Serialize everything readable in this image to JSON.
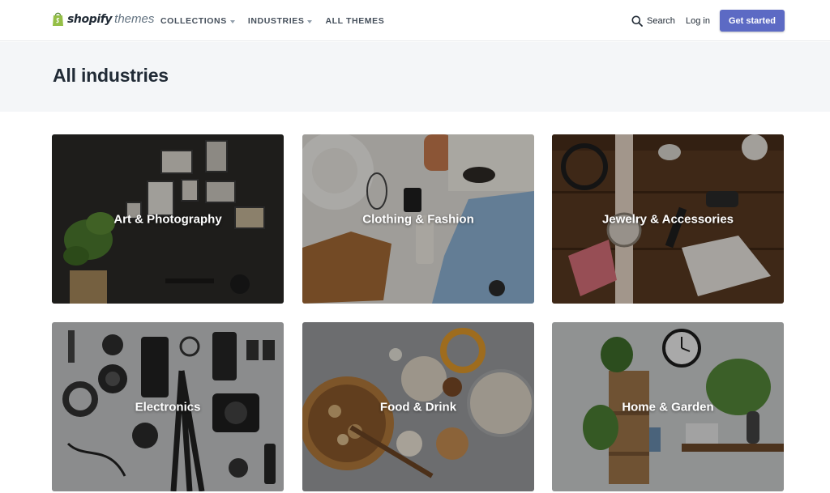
{
  "header": {
    "logo_word": "shopify",
    "logo_suffix": "themes",
    "nav": [
      {
        "label": "COLLECTIONS"
      },
      {
        "label": "INDUSTRIES"
      },
      {
        "label": "ALL THEMES"
      }
    ],
    "search_label": "Search",
    "login_label": "Log in",
    "cta_label": "Get started"
  },
  "page": {
    "title": "All industries"
  },
  "industries": [
    {
      "label": "Art & Photography"
    },
    {
      "label": "Clothing & Fashion"
    },
    {
      "label": "Jewelry & Accessories"
    },
    {
      "label": "Electronics"
    },
    {
      "label": "Food & Drink"
    },
    {
      "label": "Home & Garden"
    }
  ],
  "colors": {
    "accent": "#5c6ac4",
    "title_band": "#f4f6f8",
    "text": "#212b36",
    "logo_green": "#95bf47"
  }
}
